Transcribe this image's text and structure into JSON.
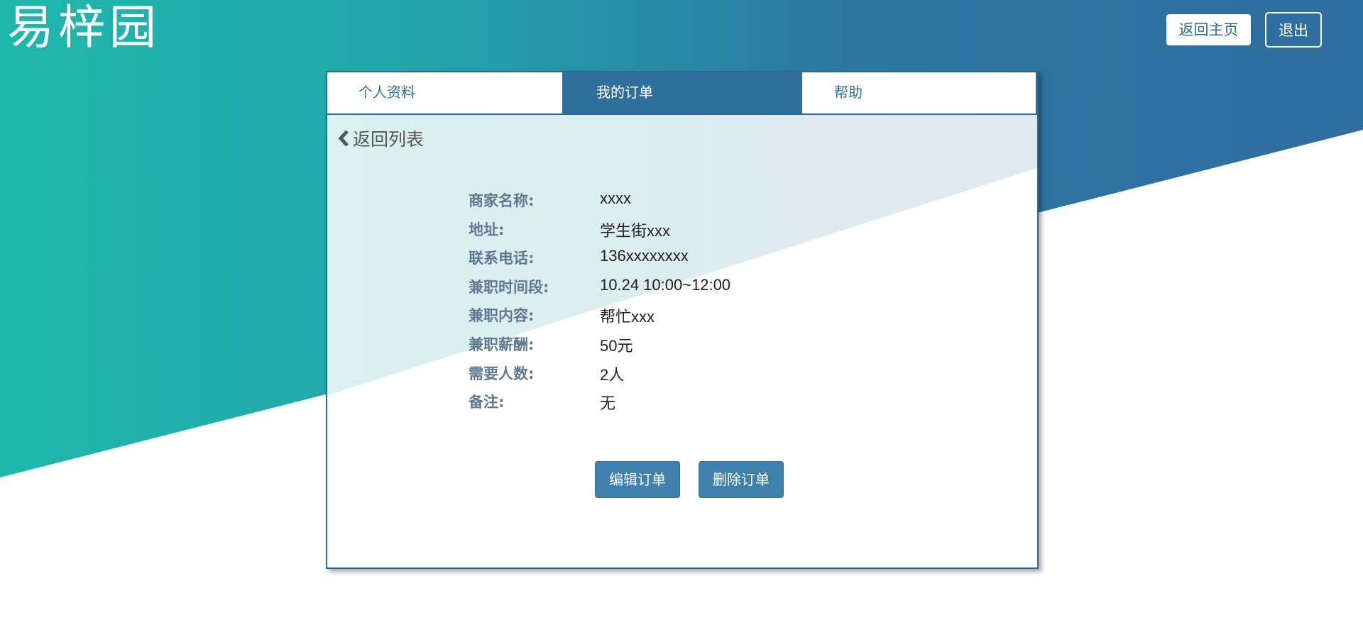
{
  "brand": {
    "logo_text": "易梓园"
  },
  "header": {
    "home_button": "返回主页",
    "logout_button": "退出"
  },
  "tabs": [
    {
      "label": "个人资料",
      "active": false
    },
    {
      "label": "我的订单",
      "active": true
    },
    {
      "label": "帮助",
      "active": false
    }
  ],
  "back_link": "返回列表",
  "order": {
    "fields": [
      {
        "label": "商家名称:",
        "value": "xxxx"
      },
      {
        "label": "地址:",
        "value": "学生街xxx"
      },
      {
        "label": "联系电话:",
        "value": "136xxxxxxxx"
      },
      {
        "label": "兼职时间段:",
        "value": "10.24 10:00~12:00"
      },
      {
        "label": "兼职内容:",
        "value": "帮忙xxx"
      },
      {
        "label": "兼职薪酬:",
        "value": "50元"
      },
      {
        "label": "需要人数:",
        "value": "2人"
      },
      {
        "label": "备注:",
        "value": "无"
      }
    ]
  },
  "actions": {
    "edit": "编辑订单",
    "delete": "删除订单"
  },
  "colors": {
    "teal": "#1fb5ab",
    "blue": "#2f6fa0",
    "button": "#3f80ad"
  }
}
